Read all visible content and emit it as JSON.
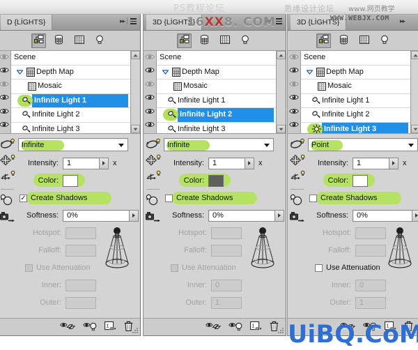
{
  "app": {
    "title": "Photoshop 3D Lights Panel",
    "panel_tab_label": "3D {LİGHTS}",
    "panel_tab_label_clipped": "D {LİGHTS}"
  },
  "watermarks": {
    "top_center": "PS教程论坛",
    "top_right_forum": "思缘设计论坛",
    "top_right_site": "www.网页教学网.com",
    "overlay_16xx_prefix": "16",
    "overlay_16xx_red": "XX",
    "overlay_16xx_suffix": "8. COM",
    "overlay_webjx": "WWW.WEBJX.COM",
    "bottom_right": "UiBQ.CoM"
  },
  "toolbar": {
    "filter_buttons": [
      {
        "name": "scene-filter",
        "icon": "scene-icon",
        "pressed": true
      },
      {
        "name": "mesh-filter",
        "icon": "mesh-icon",
        "pressed": false
      },
      {
        "name": "material-filter",
        "icon": "material-grid-icon",
        "pressed": false
      },
      {
        "name": "light-filter",
        "icon": "light-bulb-icon",
        "pressed": false
      }
    ],
    "tab_arrows": "▶▶",
    "menu_icon": "panel-menu-icon"
  },
  "bottom_bar": {
    "buttons": [
      {
        "name": "toggle-meshes-button",
        "icon": "eye-meshes-icon"
      },
      {
        "name": "toggle-lights-button",
        "icon": "eye-bulb-icon"
      },
      {
        "name": "new-light-button",
        "icon": "new-light-icon"
      },
      {
        "name": "delete-light-button",
        "icon": "trash-icon"
      }
    ]
  },
  "tree": {
    "root_label": "Scene",
    "items": [
      {
        "label": "Depth Map",
        "icon": "depth-map-icon",
        "indent": 1,
        "expanded": true,
        "selected": false,
        "highlighted": false,
        "visible": true
      },
      {
        "label": "Mosaic",
        "icon": "mosaic-texture-icon",
        "indent": 2,
        "selected": false,
        "highlighted": false,
        "visible": false
      },
      {
        "label": "Infinite Light 1",
        "icon": "infinite-light-icon",
        "indent": 3,
        "selected": false,
        "highlighted": false,
        "visible": true
      },
      {
        "label": "Infinite Light 2",
        "icon": "infinite-light-icon",
        "indent": 3,
        "selected": false,
        "highlighted": false,
        "visible": true
      },
      {
        "label": "Infinite Light 3",
        "icon": "infinite-light-icon",
        "indent": 3,
        "selected": false,
        "highlighted": false,
        "visible": true
      }
    ]
  },
  "labels": {
    "intensity": "Intensity:",
    "intensity_unit": "x",
    "color": "Color:",
    "create_shadows": "Create Shadows",
    "softness": "Softness:",
    "hotspot": "Hotspot:",
    "falloff": "Falloff:",
    "use_attenuation": "Use Attenuation",
    "inner": "Inner:",
    "outer": "Outer:"
  },
  "tools": [
    {
      "name": "rotate-light-tool",
      "icon": "rotate-light-icon"
    },
    {
      "name": "drag-light-tool",
      "icon": "drag-light-icon"
    },
    {
      "name": "slide-light-tool",
      "icon": "slide-light-icon"
    },
    {
      "name": "rotate-camera-tool",
      "icon": "rotate-camera-icon"
    },
    {
      "name": "pan-camera-tool",
      "icon": "pan-camera-icon"
    }
  ],
  "colors": {
    "selection_blue": "#1f8fe8",
    "highlight_green": "#b6e263",
    "panel_gray": "#d4d4d4",
    "watermark_blue": "#2f6fd0",
    "swatch_white": "#ffffff",
    "swatch_dark_gray": "#5f5f5f"
  },
  "panels": [
    {
      "id": "panel-left",
      "tab_label": "D {LİGHTS}",
      "selected_light": "Infinite Light 1",
      "selected_index": 2,
      "light_type": "Infinite",
      "intensity": "1",
      "color_swatch": "#ffffff",
      "create_shadows": true,
      "softness": "0%",
      "hotspot": "",
      "falloff": "",
      "use_attenuation": false,
      "attenuation_enabled": false,
      "inner": "",
      "outer": ""
    },
    {
      "id": "panel-mid",
      "tab_label": "3D {LİGHTS}",
      "selected_light": "Infinite Light 2",
      "selected_index": 3,
      "light_type": "Infinite",
      "intensity": "1",
      "color_swatch": "#5f5f5f",
      "create_shadows": false,
      "softness": "0%",
      "hotspot": "",
      "falloff": "",
      "use_attenuation": false,
      "attenuation_enabled": false,
      "inner": "0",
      "outer": "1"
    },
    {
      "id": "panel-right",
      "tab_label": "3D {LİGHTS}",
      "selected_light": "Infinite Light 3",
      "selected_index": 4,
      "light_type": "Point",
      "intensity": "1",
      "color_swatch": "#ffffff",
      "create_shadows": false,
      "softness": "0%",
      "hotspot": "",
      "falloff": "",
      "use_attenuation": false,
      "attenuation_enabled": true,
      "inner": "0",
      "outer": "1"
    }
  ]
}
